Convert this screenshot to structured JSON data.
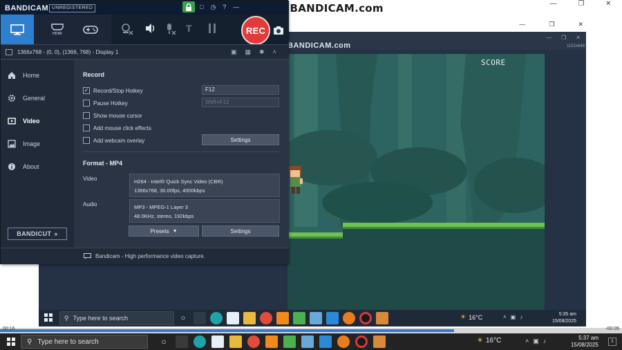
{
  "watermark": "www.BANDICAM.com",
  "inner_watermark": "BANDICAM.com",
  "inner_resolution": "1152x648",
  "bandicam": {
    "logo": "BANDICAM",
    "unregistered": "UNREGISTERED",
    "mode_hdmi_label": "HDMI",
    "rec_label": "REC",
    "capture_info": "1366x768 - (0, 0), (1366, 768) - Display 1",
    "sidebar": [
      {
        "label": "Home",
        "icon": "home-icon"
      },
      {
        "label": "General",
        "icon": "gear-icon"
      },
      {
        "label": "Video",
        "icon": "video-icon"
      },
      {
        "label": "Image",
        "icon": "image-icon"
      },
      {
        "label": "About",
        "icon": "info-icon"
      }
    ],
    "bandicut_label": "BANDICUT",
    "record": {
      "title": "Record",
      "hotkey_label": "Record/Stop Hotkey",
      "hotkey_checked": true,
      "hotkey_value": "F12",
      "pause_label": "Pause Hotkey",
      "pause_checked": false,
      "pause_value": "Shift+F12",
      "mouse_label": "Show mouse cursor",
      "mouse_checked": false,
      "click_label": "Add mouse click effects",
      "click_checked": false,
      "webcam_label": "Add webcam overlay",
      "webcam_checked": false,
      "settings_label": "Settings"
    },
    "format": {
      "title": "Format - MP4",
      "video_label": "Video",
      "video_line1": "H264 - Intel® Quick Sync Video (CBR)",
      "video_line2": "1366x768, 30.00fps, 4000kbps",
      "audio_label": "Audio",
      "audio_line1": "MP3 - MPEG-1 Layer 3",
      "audio_line2": "48.0KHz, stereo, 192kbps",
      "presets_label": "Presets",
      "settings_label": "Settings"
    },
    "status_text": "Bandicam - High performance video capture."
  },
  "game": {
    "score_label": "SCORE"
  },
  "inner_taskbar": {
    "search_placeholder": "Type here to search",
    "temperature": "16°C",
    "time": "5:35 am",
    "date": "15/08/2025"
  },
  "video_progress": {
    "elapsed": "00:16",
    "remaining": "-00:05",
    "fraction": 0.73
  },
  "outer_taskbar": {
    "search_placeholder": "Type here to search",
    "temperature": "16°C",
    "time": "5:37 am",
    "date": "15/08/2025"
  },
  "colors": {
    "accent": "#2f7fd1",
    "rec": "#e03a3a",
    "lock": "#37a24a"
  }
}
